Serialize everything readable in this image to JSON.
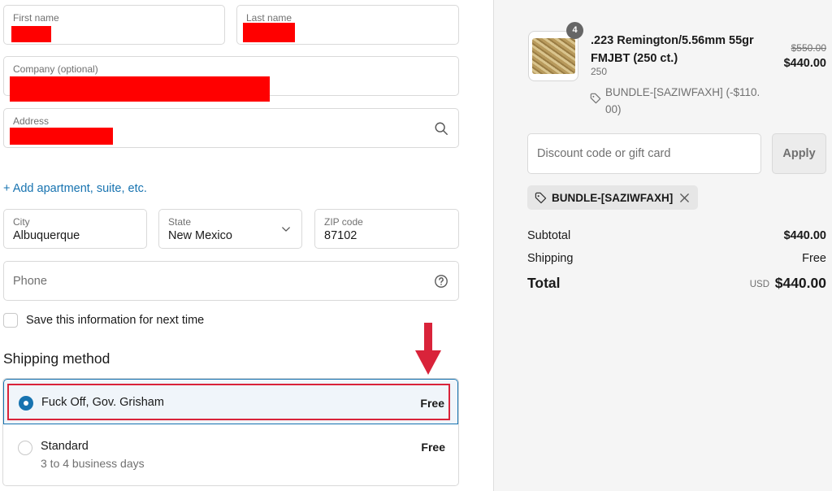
{
  "form": {
    "first_name_label": "First name",
    "last_name_label": "Last name",
    "company_label": "Company (optional)",
    "address_label": "Address",
    "add_apartment": "+ Add apartment, suite, etc.",
    "city_label": "City",
    "city_value": "Albuquerque",
    "state_label": "State",
    "state_value": "New Mexico",
    "zip_label": "ZIP code",
    "zip_value": "87102",
    "phone_placeholder": "Phone",
    "save_info_label": "Save this information for next time"
  },
  "shipping": {
    "title": "Shipping method",
    "options": [
      {
        "name": "Fuck Off, Gov. Grisham",
        "price": "Free",
        "selected": true
      },
      {
        "name": "Standard",
        "sub": "3 to 4 business days",
        "price": "Free",
        "selected": false
      }
    ]
  },
  "annotation": {
    "color": "#d9233a"
  },
  "summary": {
    "product": {
      "qty": "4",
      "name": ".223 Remington/5.56mm 55gr FMJBT (250 ct.)",
      "variant": "250",
      "discount": "BUNDLE-[SAZIWFAXH] (-$110.00)",
      "price_old": "$550.00",
      "price_new": "$440.00"
    },
    "discount_placeholder": "Discount code or gift card",
    "apply_label": "Apply",
    "applied_code": "BUNDLE-[SAZIWFAXH]",
    "subtotal_label": "Subtotal",
    "subtotal_value": "$440.00",
    "shipping_label": "Shipping",
    "shipping_value": "Free",
    "total_label": "Total",
    "currency": "USD",
    "total_value": "$440.00"
  },
  "colors": {
    "accent": "#1773b0",
    "redaction": "#ff0000",
    "sidebar_bg": "#f5f5f5"
  }
}
